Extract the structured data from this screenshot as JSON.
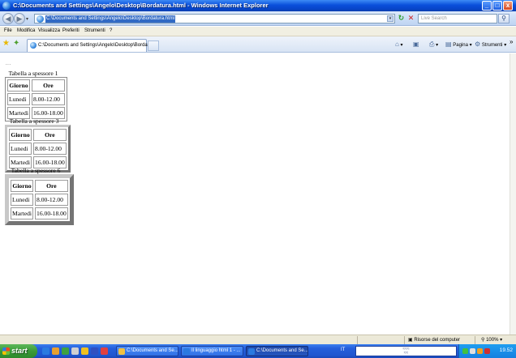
{
  "window": {
    "title": "C:\\Documents and Settings\\Angelo\\Desktop\\Bordatura.html - Windows Internet Explorer",
    "controls": {
      "minimize": "_",
      "maximize": "□",
      "close": "x"
    }
  },
  "address_bar": {
    "url": "C:\\Documents and Settings\\Angelo\\Desktop\\Bordatura.html",
    "search_placeholder": "Live Search"
  },
  "menu": [
    "File",
    "Modifica",
    "Visualizza",
    "Preferiti",
    "Strumenti",
    "?"
  ],
  "tab": {
    "label": "C:\\Documents and Settings\\Angelo\\Desktop\\Bordatur..."
  },
  "toolbar": {
    "page_label": "Pagina",
    "tools_label": "Strumenti",
    "more": "»"
  },
  "page": {
    "dots": "...",
    "tables": [
      {
        "caption": "Tabella a spessore 1",
        "headers": [
          "Giorno",
          "Ore"
        ],
        "rows": [
          [
            "Lunedi",
            "8.00-12.00"
          ],
          [
            "Martedi",
            "16.00-18.00"
          ]
        ]
      },
      {
        "caption": "Tabella a spessore 3",
        "headers": [
          "Giorno",
          "Ore"
        ],
        "rows": [
          [
            "Lunedi",
            "8.00-12.00"
          ],
          [
            "Martedi",
            "16.00-18.00"
          ]
        ]
      },
      {
        "caption": "Tabella a spessore 6",
        "headers": [
          "Giorno",
          "Ore"
        ],
        "rows": [
          [
            "Lunedi",
            "8.00-12.00"
          ],
          [
            "Martedi",
            "16.00-18.00"
          ]
        ]
      }
    ]
  },
  "statusbar": {
    "zone": "Risorse del computer",
    "zoom": "100%"
  },
  "taskbar": {
    "start": "start",
    "tasks": [
      "C:\\Documents and Se...",
      "Il linguaggio html 1 - ...",
      "C:\\Documents and Se..."
    ],
    "lang": "IT",
    "clock": "19.52"
  }
}
